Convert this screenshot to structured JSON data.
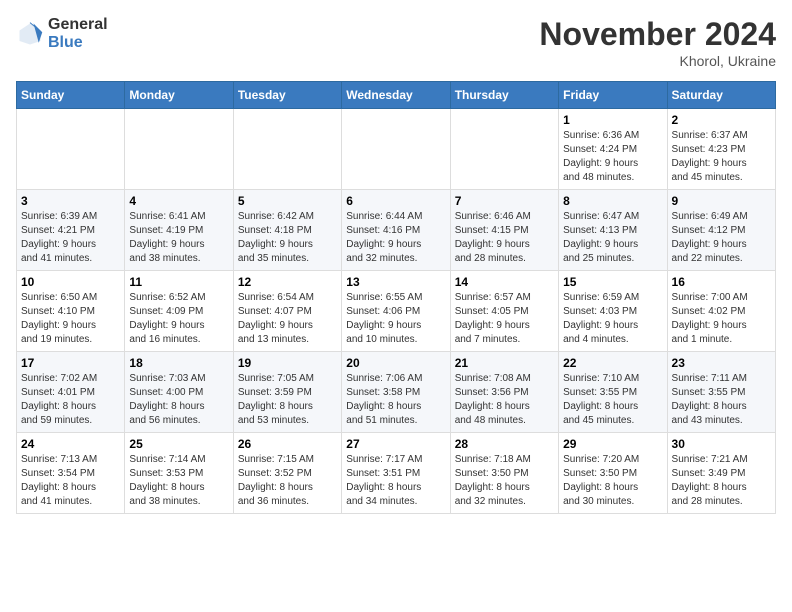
{
  "header": {
    "logo_general": "General",
    "logo_blue": "Blue",
    "month_title": "November 2024",
    "location": "Khorol, Ukraine"
  },
  "weekdays": [
    "Sunday",
    "Monday",
    "Tuesday",
    "Wednesday",
    "Thursday",
    "Friday",
    "Saturday"
  ],
  "weeks": [
    [
      {
        "day": "",
        "info": ""
      },
      {
        "day": "",
        "info": ""
      },
      {
        "day": "",
        "info": ""
      },
      {
        "day": "",
        "info": ""
      },
      {
        "day": "",
        "info": ""
      },
      {
        "day": "1",
        "info": "Sunrise: 6:36 AM\nSunset: 4:24 PM\nDaylight: 9 hours\nand 48 minutes."
      },
      {
        "day": "2",
        "info": "Sunrise: 6:37 AM\nSunset: 4:23 PM\nDaylight: 9 hours\nand 45 minutes."
      }
    ],
    [
      {
        "day": "3",
        "info": "Sunrise: 6:39 AM\nSunset: 4:21 PM\nDaylight: 9 hours\nand 41 minutes."
      },
      {
        "day": "4",
        "info": "Sunrise: 6:41 AM\nSunset: 4:19 PM\nDaylight: 9 hours\nand 38 minutes."
      },
      {
        "day": "5",
        "info": "Sunrise: 6:42 AM\nSunset: 4:18 PM\nDaylight: 9 hours\nand 35 minutes."
      },
      {
        "day": "6",
        "info": "Sunrise: 6:44 AM\nSunset: 4:16 PM\nDaylight: 9 hours\nand 32 minutes."
      },
      {
        "day": "7",
        "info": "Sunrise: 6:46 AM\nSunset: 4:15 PM\nDaylight: 9 hours\nand 28 minutes."
      },
      {
        "day": "8",
        "info": "Sunrise: 6:47 AM\nSunset: 4:13 PM\nDaylight: 9 hours\nand 25 minutes."
      },
      {
        "day": "9",
        "info": "Sunrise: 6:49 AM\nSunset: 4:12 PM\nDaylight: 9 hours\nand 22 minutes."
      }
    ],
    [
      {
        "day": "10",
        "info": "Sunrise: 6:50 AM\nSunset: 4:10 PM\nDaylight: 9 hours\nand 19 minutes."
      },
      {
        "day": "11",
        "info": "Sunrise: 6:52 AM\nSunset: 4:09 PM\nDaylight: 9 hours\nand 16 minutes."
      },
      {
        "day": "12",
        "info": "Sunrise: 6:54 AM\nSunset: 4:07 PM\nDaylight: 9 hours\nand 13 minutes."
      },
      {
        "day": "13",
        "info": "Sunrise: 6:55 AM\nSunset: 4:06 PM\nDaylight: 9 hours\nand 10 minutes."
      },
      {
        "day": "14",
        "info": "Sunrise: 6:57 AM\nSunset: 4:05 PM\nDaylight: 9 hours\nand 7 minutes."
      },
      {
        "day": "15",
        "info": "Sunrise: 6:59 AM\nSunset: 4:03 PM\nDaylight: 9 hours\nand 4 minutes."
      },
      {
        "day": "16",
        "info": "Sunrise: 7:00 AM\nSunset: 4:02 PM\nDaylight: 9 hours\nand 1 minute."
      }
    ],
    [
      {
        "day": "17",
        "info": "Sunrise: 7:02 AM\nSunset: 4:01 PM\nDaylight: 8 hours\nand 59 minutes."
      },
      {
        "day": "18",
        "info": "Sunrise: 7:03 AM\nSunset: 4:00 PM\nDaylight: 8 hours\nand 56 minutes."
      },
      {
        "day": "19",
        "info": "Sunrise: 7:05 AM\nSunset: 3:59 PM\nDaylight: 8 hours\nand 53 minutes."
      },
      {
        "day": "20",
        "info": "Sunrise: 7:06 AM\nSunset: 3:58 PM\nDaylight: 8 hours\nand 51 minutes."
      },
      {
        "day": "21",
        "info": "Sunrise: 7:08 AM\nSunset: 3:56 PM\nDaylight: 8 hours\nand 48 minutes."
      },
      {
        "day": "22",
        "info": "Sunrise: 7:10 AM\nSunset: 3:55 PM\nDaylight: 8 hours\nand 45 minutes."
      },
      {
        "day": "23",
        "info": "Sunrise: 7:11 AM\nSunset: 3:55 PM\nDaylight: 8 hours\nand 43 minutes."
      }
    ],
    [
      {
        "day": "24",
        "info": "Sunrise: 7:13 AM\nSunset: 3:54 PM\nDaylight: 8 hours\nand 41 minutes."
      },
      {
        "day": "25",
        "info": "Sunrise: 7:14 AM\nSunset: 3:53 PM\nDaylight: 8 hours\nand 38 minutes."
      },
      {
        "day": "26",
        "info": "Sunrise: 7:15 AM\nSunset: 3:52 PM\nDaylight: 8 hours\nand 36 minutes."
      },
      {
        "day": "27",
        "info": "Sunrise: 7:17 AM\nSunset: 3:51 PM\nDaylight: 8 hours\nand 34 minutes."
      },
      {
        "day": "28",
        "info": "Sunrise: 7:18 AM\nSunset: 3:50 PM\nDaylight: 8 hours\nand 32 minutes."
      },
      {
        "day": "29",
        "info": "Sunrise: 7:20 AM\nSunset: 3:50 PM\nDaylight: 8 hours\nand 30 minutes."
      },
      {
        "day": "30",
        "info": "Sunrise: 7:21 AM\nSunset: 3:49 PM\nDaylight: 8 hours\nand 28 minutes."
      }
    ]
  ]
}
